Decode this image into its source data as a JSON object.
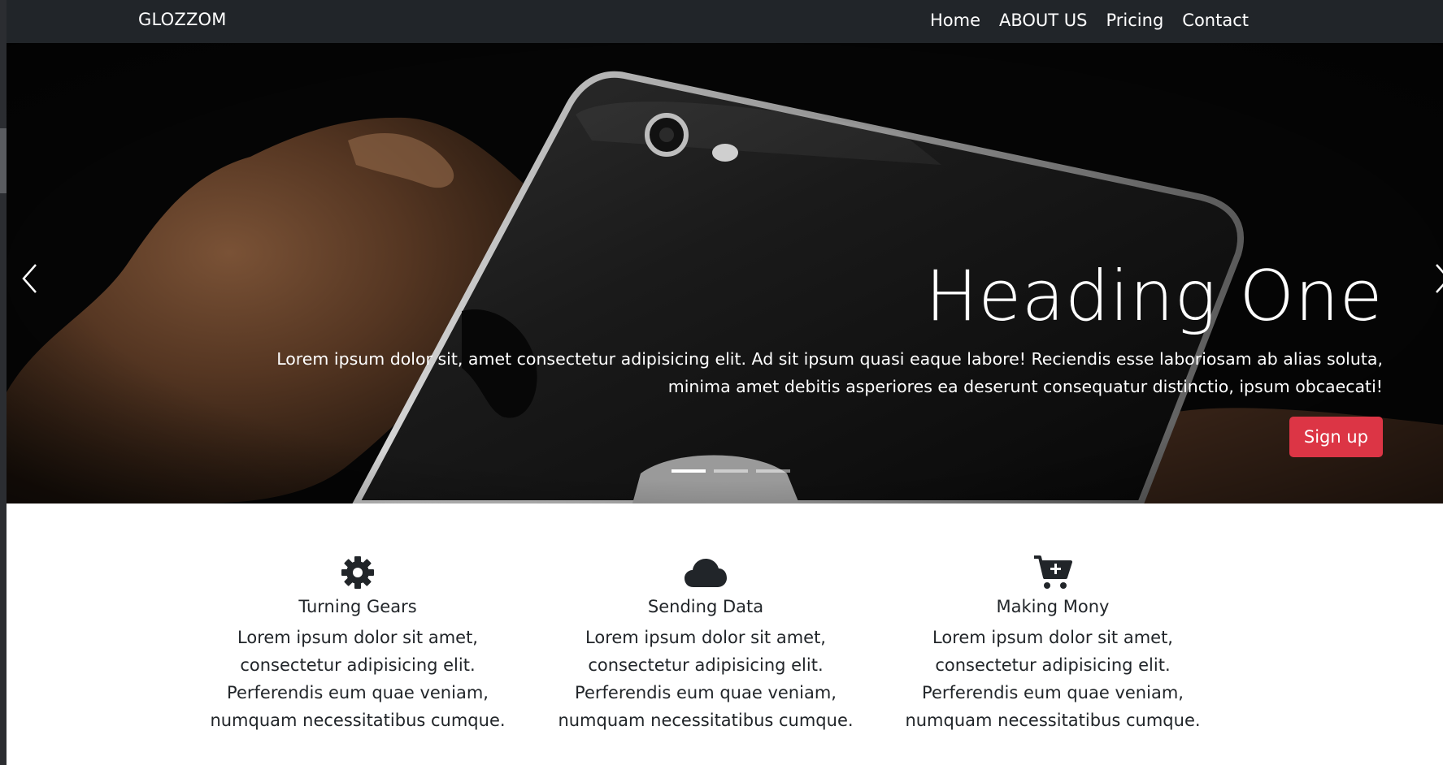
{
  "nav": {
    "brand": "GLOZZOM",
    "links": [
      "Home",
      "ABOUT US",
      "Pricing",
      "Contact"
    ]
  },
  "hero": {
    "heading": "Heading One",
    "text": "Lorem ipsum dolor sit, amet consectetur adipisicing elit. Ad sit ipsum quasi eaque labore! Reciendis esse laboriosam ab alias soluta, minima amet debitis asperiores ea deserunt consequatur distinctio, ipsum obcaecati!",
    "button": "Sign up",
    "button_color": "#dc3545",
    "prev_icon": "chevron-left-icon",
    "next_icon": "chevron-right-icon"
  },
  "features": [
    {
      "icon": "gear-icon",
      "title": "Turning Gears",
      "text": "Lorem ipsum dolor sit amet, consectetur adipisicing elit. Perferendis eum quae veniam, numquam necessitatibus cumque."
    },
    {
      "icon": "cloud-icon",
      "title": "Sending Data",
      "text": "Lorem ipsum dolor sit amet, consectetur adipisicing elit. Perferendis eum quae veniam, numquam necessitatibus cumque."
    },
    {
      "icon": "cart-plus-icon",
      "title": "Making Mony",
      "text": "Lorem ipsum dolor sit amet, consectetur adipisicing elit. Perferendis eum quae veniam, numquam necessitatibus cumque."
    }
  ],
  "colors": {
    "navbar": "#212529",
    "hero_background": "#060606",
    "text": "#212529"
  }
}
